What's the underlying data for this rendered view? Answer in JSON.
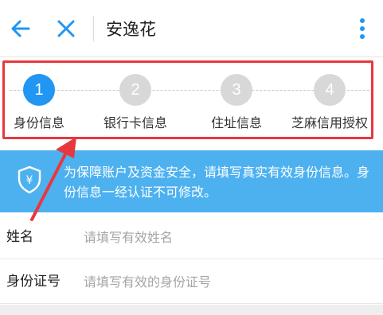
{
  "header": {
    "title": "安逸花",
    "back_icon": "back-arrow-icon",
    "close_icon": "close-icon",
    "more_icon": "more-vertical-icon"
  },
  "steps": [
    {
      "number": "1",
      "label": "身份信息",
      "active": true
    },
    {
      "number": "2",
      "label": "银行卡信息",
      "active": false
    },
    {
      "number": "3",
      "label": "住址信息",
      "active": false
    },
    {
      "number": "4",
      "label": "芝麻信用授权",
      "active": false
    }
  ],
  "notice": {
    "icon": "shield-yuan-icon",
    "text": "为保障账户及资金安全，请填写真实有效身份信息。身份信息一经认证不可修改。"
  },
  "form": {
    "name_label": "姓名",
    "name_placeholder": "请填写有效姓名",
    "id_label": "身份证号",
    "id_placeholder": "请填写有效的身份证号"
  },
  "colors": {
    "accent": "#2196f3",
    "banner": "#4db1f0",
    "annotation": "#e8383d",
    "inactive_step": "#d8d8d8"
  }
}
